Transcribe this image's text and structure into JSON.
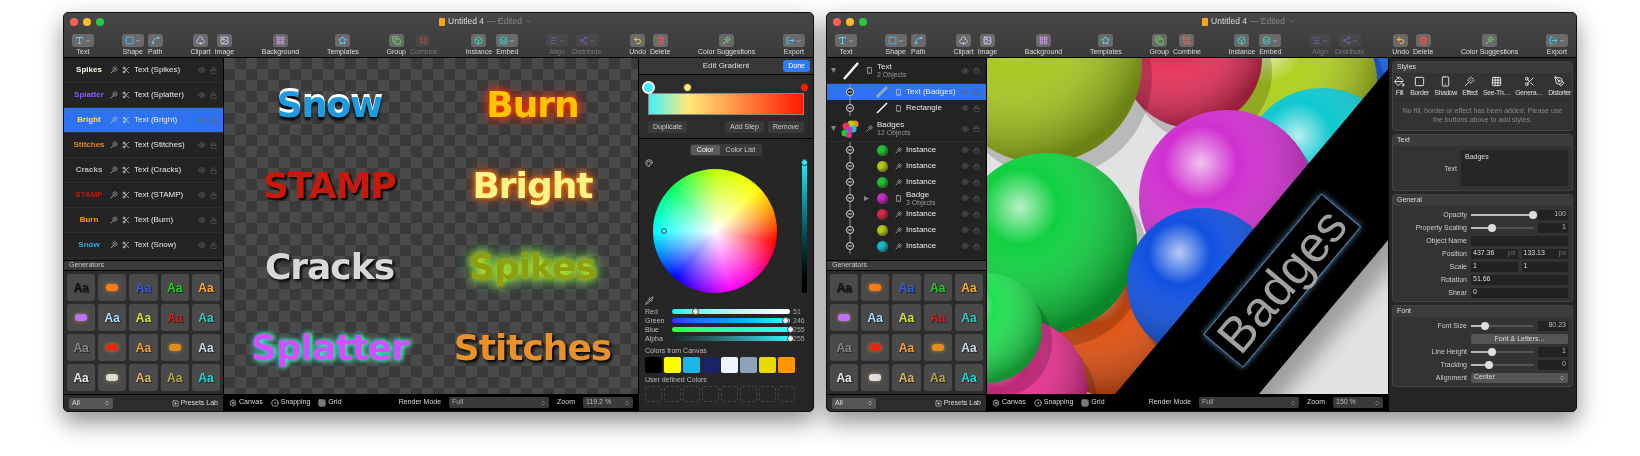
{
  "windows": [
    {
      "title": "Untitled 4",
      "status": "— Edited",
      "toolbar": [
        {
          "items": [
            {
              "label": "Text",
              "disabled": false
            }
          ]
        },
        {
          "items": [
            {
              "label": "Shape",
              "disabled": false
            },
            {
              "label": "Path",
              "disabled": false
            }
          ]
        },
        {
          "items": [
            {
              "label": "Clipart",
              "disabled": false
            },
            {
              "label": "Image",
              "disabled": false
            }
          ]
        },
        {
          "items": [
            {
              "label": "Background",
              "disabled": false
            }
          ]
        },
        {
          "items": [
            {
              "label": "Templates",
              "disabled": false
            }
          ]
        },
        {
          "items": [
            {
              "label": "Group",
              "disabled": false
            },
            {
              "label": "Combine",
              "disabled": true
            }
          ]
        },
        {
          "items": [
            {
              "label": "Instance",
              "disabled": false
            },
            {
              "label": "Embed",
              "disabled": false
            }
          ]
        },
        {
          "items": [
            {
              "label": "Align",
              "disabled": true
            },
            {
              "label": "Distribute",
              "disabled": true
            }
          ]
        },
        {
          "items": [
            {
              "label": "Undo",
              "disabled": false
            },
            {
              "label": "Delete",
              "disabled": false
            }
          ]
        },
        {
          "items": [
            {
              "label": "Color Suggestions",
              "disabled": false
            }
          ]
        },
        {
          "items": [
            {
              "label": "Export",
              "disabled": false
            }
          ]
        }
      ],
      "sidebar": {
        "layers": [
          {
            "kind": "effect",
            "thumb": "Spikes",
            "color": "#f0ffe0",
            "label": "Text (Spikes)",
            "selected": false
          },
          {
            "kind": "effect",
            "thumb": "Splatter",
            "color": "#8a5cff",
            "label": "Text (Splatter)",
            "selected": false
          },
          {
            "kind": "effect",
            "thumb": "Bright",
            "color": "#ffe040",
            "label": "Text (Bright)",
            "selected": true
          },
          {
            "kind": "effect",
            "thumb": "Stitches",
            "color": "#d88a2a",
            "label": "Text (Stitches)",
            "selected": false
          },
          {
            "kind": "effect",
            "thumb": "Cracks",
            "color": "#bbbbbb",
            "label": "Text (Cracks)",
            "selected": false
          },
          {
            "kind": "effect",
            "thumb": "STAMP",
            "color": "#c0180c",
            "label": "Text (STAMP)",
            "selected": false
          },
          {
            "kind": "effect",
            "thumb": "Burn",
            "color": "#ff9a00",
            "label": "Text (Burn)",
            "selected": false
          },
          {
            "kind": "effect",
            "thumb": "Snow",
            "color": "#2ea8e0",
            "label": "Text (Snow)",
            "selected": false
          }
        ],
        "generators_title": "Generators",
        "generators": [
          {
            "kind": "text",
            "label": "Aa",
            "color": "#141414"
          },
          {
            "kind": "blob",
            "color": "#ff7a10"
          },
          {
            "kind": "text",
            "label": "Aa",
            "color": "#3a5ee0"
          },
          {
            "kind": "text",
            "label": "Aa",
            "color": "#22cc22"
          },
          {
            "kind": "text",
            "label": "Aa",
            "color": "#ffaa20"
          },
          {
            "kind": "blob",
            "color": "#c070ff"
          },
          {
            "kind": "text",
            "label": "Aa",
            "color": "#a8dcff"
          },
          {
            "kind": "text",
            "label": "Aa",
            "color": "#d8e040"
          },
          {
            "kind": "text",
            "label": "Aa",
            "color": "#cc2222"
          },
          {
            "kind": "text",
            "label": "Aa",
            "color": "#30c8c0"
          },
          {
            "kind": "text",
            "label": "Aa",
            "color": "#888888"
          },
          {
            "kind": "blob",
            "color": "#e02a10"
          },
          {
            "kind": "text",
            "label": "Aa",
            "color": "#f0a030"
          },
          {
            "kind": "blob",
            "color": "#e0901a"
          },
          {
            "kind": "text",
            "label": "Aa",
            "color": "#c8dcec"
          },
          {
            "kind": "text",
            "label": "Aa",
            "color": "#e8e8e8"
          },
          {
            "kind": "blob",
            "color": "#dddddd"
          },
          {
            "kind": "text",
            "label": "Aa",
            "color": "#d8b860"
          },
          {
            "kind": "text",
            "label": "Aa",
            "color": "#b8a848"
          },
          {
            "kind": "text",
            "label": "Aa",
            "color": "#20d8d8"
          }
        ],
        "filter": "All",
        "presets_button": "Presets Lab"
      },
      "canvas": {
        "kind": "effects",
        "items": [
          {
            "text": "Snow",
            "color": "#1e9be0"
          },
          {
            "text": "Burn",
            "color": "#ffc400"
          },
          {
            "text": "STAMP",
            "color": "#c81a0c"
          },
          {
            "text": "Bright",
            "color": "#fff38a"
          },
          {
            "text": "Cracks",
            "color": "#d8d8d8"
          },
          {
            "text": "Spikes",
            "color": "#8ea010"
          },
          {
            "text": "Splatter",
            "color": "#d050ff"
          },
          {
            "text": "Stitches",
            "color": "#e8902a"
          }
        ]
      },
      "status_bar": {
        "canvas": "Canvas",
        "snapping": "Snapping",
        "grid": "Grid",
        "render_label": "Render Mode",
        "render_value": "Full",
        "zoom_label": "Zoom",
        "zoom_value": "119.2 %"
      },
      "panel": {
        "kind": "gradient",
        "title": "Edit Gradient",
        "done": "Done",
        "stops": [
          {
            "color": "#3ff0ff",
            "level": 0,
            "selected": true
          },
          {
            "color": "#ffe97a",
            "level": 0.25,
            "selected": false
          },
          {
            "color": "#ff1a00",
            "level": 1,
            "selected": false
          }
        ],
        "actions": [
          "Duplicate",
          "Add Step",
          "Remove"
        ],
        "tabs": [
          {
            "label": "Color",
            "selected": true
          },
          {
            "label": "Color List",
            "selected": false
          }
        ],
        "brightness": {
          "level": 1
        },
        "channels": [
          {
            "label": "Red",
            "level": 0.2,
            "value": "51"
          },
          {
            "label": "Green",
            "level": 0.96,
            "value": "246"
          },
          {
            "label": "Blue",
            "level": 1,
            "value": "255"
          },
          {
            "label": "Alpha",
            "level": 1,
            "value": "255"
          }
        ],
        "canvas_colors_title": "Colors from Canvas",
        "canvas_colors": [
          {
            "color": "#000000"
          },
          {
            "color": "#ffff00"
          },
          {
            "color": "#1ab8e8"
          },
          {
            "color": "#1a2366"
          },
          {
            "color": "#eef5ff"
          },
          {
            "color": "#8fa3b8"
          },
          {
            "color": "#e8d800"
          },
          {
            "color": "#ff9500"
          }
        ],
        "user_colors_title": "User defined Colors"
      }
    },
    {
      "title": "Untitled 4",
      "status": "— Edited",
      "toolbar": [
        {
          "items": [
            {
              "label": "Text",
              "disabled": false
            }
          ]
        },
        {
          "items": [
            {
              "label": "Shape",
              "disabled": false
            },
            {
              "label": "Path",
              "disabled": false
            }
          ]
        },
        {
          "items": [
            {
              "label": "Clipart",
              "disabled": false
            },
            {
              "label": "Image",
              "disabled": false
            }
          ]
        },
        {
          "items": [
            {
              "label": "Background",
              "disabled": false
            }
          ]
        },
        {
          "items": [
            {
              "label": "Templates",
              "disabled": false
            }
          ]
        },
        {
          "items": [
            {
              "label": "Group",
              "disabled": false
            },
            {
              "label": "Combine",
              "disabled": false
            }
          ]
        },
        {
          "items": [
            {
              "label": "Instance",
              "disabled": false
            },
            {
              "label": "Embed",
              "disabled": false
            }
          ]
        },
        {
          "items": [
            {
              "label": "Align",
              "disabled": true
            },
            {
              "label": "Distribute",
              "disabled": true
            }
          ]
        },
        {
          "items": [
            {
              "label": "Undo",
              "disabled": false
            },
            {
              "label": "Delete",
              "disabled": false
            }
          ]
        },
        {
          "items": [
            {
              "label": "Color Suggestions",
              "disabled": false
            }
          ]
        },
        {
          "items": [
            {
              "label": "Export",
              "disabled": false
            }
          ]
        }
      ],
      "sidebar": {
        "layers": [
          {
            "kind": "line-group",
            "label": "Text",
            "sub": "2 Objects",
            "expanded": true,
            "selected": false,
            "children": [
              {
                "kind": "text",
                "label": "Text (Badges)",
                "selected": true
              },
              {
                "kind": "line",
                "label": "Rectangle",
                "selected": false
              }
            ]
          },
          {
            "kind": "ball-group",
            "label": "Badges",
            "sub": "12 Objects",
            "expanded": true,
            "selected": false,
            "children": [
              {
                "kind": "ball",
                "label": "Instance",
                "color": "#1fbf3a",
                "selected": false
              },
              {
                "kind": "ball",
                "label": "Instance",
                "color": "#b8c41a",
                "selected": false
              },
              {
                "kind": "ball",
                "label": "Instance",
                "color": "#1fbf3a",
                "selected": false
              },
              {
                "kind": "ball",
                "label": "Badge",
                "sub": "3 Objects",
                "color": "#c230c2",
                "expanded": false,
                "selected": false
              },
              {
                "kind": "ball",
                "label": "Instance",
                "color": "#d42a4a",
                "selected": false
              },
              {
                "kind": "ball",
                "label": "Instance",
                "color": "#b8c41a",
                "selected": false
              },
              {
                "kind": "ball",
                "label": "Instance",
                "color": "#18b8c8",
                "selected": false
              }
            ]
          }
        ],
        "generators_title": "Generators",
        "generators": [
          {
            "kind": "text",
            "label": "Aa",
            "color": "#141414"
          },
          {
            "kind": "blob",
            "color": "#ff7a10"
          },
          {
            "kind": "text",
            "label": "Aa",
            "color": "#3a5ee0"
          },
          {
            "kind": "text",
            "label": "Aa",
            "color": "#22cc22"
          },
          {
            "kind": "text",
            "label": "Aa",
            "color": "#ffaa20"
          },
          {
            "kind": "blob",
            "color": "#c070ff"
          },
          {
            "kind": "text",
            "label": "Aa",
            "color": "#a8dcff"
          },
          {
            "kind": "text",
            "label": "Aa",
            "color": "#d8e040"
          },
          {
            "kind": "text",
            "label": "Aa",
            "color": "#cc2222"
          },
          {
            "kind": "text",
            "label": "Aa",
            "color": "#30c8c0"
          },
          {
            "kind": "text",
            "label": "Aa",
            "color": "#888888"
          },
          {
            "kind": "blob",
            "color": "#e02a10"
          },
          {
            "kind": "text",
            "label": "Aa",
            "color": "#f0a030"
          },
          {
            "kind": "blob",
            "color": "#e0901a"
          },
          {
            "kind": "text",
            "label": "Aa",
            "color": "#c8dcec"
          },
          {
            "kind": "text",
            "label": "Aa",
            "color": "#e8e8e8"
          },
          {
            "kind": "blob",
            "color": "#dddddd"
          },
          {
            "kind": "text",
            "label": "Aa",
            "color": "#d8b860"
          },
          {
            "kind": "text",
            "label": "Aa",
            "color": "#b8a848"
          },
          {
            "kind": "text",
            "label": "Aa",
            "color": "#20d8d8"
          }
        ],
        "filter": "All",
        "presets_button": "Presets Lab"
      },
      "canvas": {
        "kind": "badges",
        "text": "Badges"
      },
      "status_bar": {
        "canvas": "Canvas",
        "snapping": "Snapping",
        "grid": "Grid",
        "render_label": "Render Mode",
        "render_value": "Full",
        "zoom_label": "Zoom",
        "zoom_value": "150 %"
      },
      "panel": {
        "kind": "inspector",
        "sections": [
          {
            "kind": "styles",
            "title": "Styles",
            "buttons": [
              "Fill",
              "Border",
              "Shadow",
              "Effect",
              "See-Th…",
              "Genera…",
              "Distorter"
            ],
            "message": "No fill, border or effect has been added. Please use the buttons above to add styles."
          },
          {
            "kind": "text",
            "title": "Text",
            "label": "Text",
            "value": "Badges"
          },
          {
            "kind": "rows",
            "title": "General",
            "rows": [
              {
                "kind": "slider",
                "label": "Opacity",
                "level": 0.98,
                "value": "100"
              },
              {
                "kind": "slider",
                "label": "Property Scaling",
                "level": 0.33,
                "value": "1"
              },
              {
                "kind": "field",
                "label": "Object Name"
              },
              {
                "kind": "pair",
                "label": "Position",
                "values": [
                  "437.36",
                  "133.13"
                ],
                "units": [
                  "px",
                  "px"
                ]
              },
              {
                "kind": "pair",
                "label": "Scale",
                "values": [
                  "1",
                  "1"
                ]
              },
              {
                "kind": "field",
                "label": "Rotation",
                "value": "51.66"
              },
              {
                "kind": "field",
                "label": "Shear",
                "value": "0"
              }
            ]
          },
          {
            "kind": "rows",
            "title": "Font",
            "rows": [
              {
                "kind": "slider",
                "label": "Font Size",
                "level": 0.22,
                "value": "80.23"
              },
              {
                "kind": "button",
                "label": "Font & Letters..."
              },
              {
                "kind": "slider",
                "label": "Line Height",
                "level": 0.33,
                "value": "1"
              },
              {
                "kind": "slider",
                "label": "Tracking",
                "level": 0.28,
                "value": "0"
              },
              {
                "kind": "select",
                "label": "Alignment",
                "value": "Center"
              }
            ]
          }
        ]
      }
    }
  ]
}
